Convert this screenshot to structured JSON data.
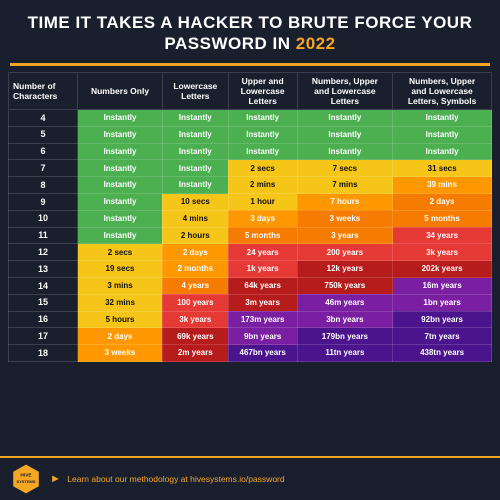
{
  "header": {
    "title": "TIME IT TAKES A HACKER TO BRUTE FORCE YOUR PASSWORD IN",
    "year": "2022"
  },
  "table": {
    "columns": [
      "Number of Characters",
      "Numbers Only",
      "Lowercase Letters",
      "Upper and Lowercase Letters",
      "Numbers, Upper and Lowercase Letters",
      "Numbers, Upper and Lowercase Letters, Symbols"
    ],
    "rows": [
      {
        "chars": "4",
        "num": "Instantly",
        "lower": "Instantly",
        "mixed": "Instantly",
        "num_mixed": "Instantly",
        "all": "Instantly",
        "colors": [
          "green",
          "green",
          "green",
          "green",
          "green"
        ]
      },
      {
        "chars": "5",
        "num": "Instantly",
        "lower": "Instantly",
        "mixed": "Instantly",
        "num_mixed": "Instantly",
        "all": "Instantly",
        "colors": [
          "green",
          "green",
          "green",
          "green",
          "green"
        ]
      },
      {
        "chars": "6",
        "num": "Instantly",
        "lower": "Instantly",
        "mixed": "Instantly",
        "num_mixed": "Instantly",
        "all": "Instantly",
        "colors": [
          "green",
          "green",
          "green",
          "green",
          "green"
        ]
      },
      {
        "chars": "7",
        "num": "Instantly",
        "lower": "Instantly",
        "mixed": "2 secs",
        "num_mixed": "7 secs",
        "all": "31 secs",
        "colors": [
          "green",
          "green",
          "yellow-cell",
          "yellow-cell",
          "yellow-cell"
        ]
      },
      {
        "chars": "8",
        "num": "Instantly",
        "lower": "Instantly",
        "mixed": "2 mins",
        "num_mixed": "7 mins",
        "all": "39 mins",
        "colors": [
          "green",
          "green",
          "yellow-cell",
          "yellow-cell",
          "orange-light"
        ]
      },
      {
        "chars": "9",
        "num": "Instantly",
        "lower": "10 secs",
        "mixed": "1 hour",
        "num_mixed": "7 hours",
        "all": "2 days",
        "colors": [
          "green",
          "yellow-cell",
          "yellow-cell",
          "orange-light",
          "orange"
        ]
      },
      {
        "chars": "10",
        "num": "Instantly",
        "lower": "4 mins",
        "mixed": "3 days",
        "num_mixed": "3 weeks",
        "all": "5 months",
        "colors": [
          "green",
          "yellow-cell",
          "orange-light",
          "orange",
          "orange"
        ]
      },
      {
        "chars": "11",
        "num": "Instantly",
        "lower": "2 hours",
        "mixed": "5 months",
        "num_mixed": "3 years",
        "all": "34 years",
        "colors": [
          "green",
          "yellow-cell",
          "orange",
          "orange",
          "red"
        ]
      },
      {
        "chars": "12",
        "num": "2 secs",
        "lower": "2 days",
        "mixed": "24 years",
        "num_mixed": "200 years",
        "all": "3k years",
        "colors": [
          "yellow-cell",
          "orange-light",
          "red",
          "red",
          "red"
        ]
      },
      {
        "chars": "13",
        "num": "19 secs",
        "lower": "2 months",
        "mixed": "1k years",
        "num_mixed": "12k years",
        "all": "202k years",
        "colors": [
          "yellow-cell",
          "orange-light",
          "red",
          "dark-red",
          "dark-red"
        ]
      },
      {
        "chars": "14",
        "num": "3 mins",
        "lower": "4 years",
        "mixed": "64k years",
        "num_mixed": "750k years",
        "all": "16m years",
        "colors": [
          "yellow-cell",
          "orange",
          "dark-red",
          "dark-red",
          "purple"
        ]
      },
      {
        "chars": "15",
        "num": "32 mins",
        "lower": "100 years",
        "mixed": "3m years",
        "num_mixed": "46m years",
        "all": "1bn years",
        "colors": [
          "yellow-cell",
          "red",
          "dark-red",
          "purple",
          "purple"
        ]
      },
      {
        "chars": "16",
        "num": "5 hours",
        "lower": "3k years",
        "mixed": "173m years",
        "num_mixed": "3bn years",
        "all": "92bn years",
        "colors": [
          "yellow-cell",
          "red",
          "purple",
          "purple",
          "dark-purple"
        ]
      },
      {
        "chars": "17",
        "num": "2 days",
        "lower": "69k years",
        "mixed": "9bn years",
        "num_mixed": "179bn years",
        "all": "7tn years",
        "colors": [
          "orange-light",
          "dark-red",
          "purple",
          "dark-purple",
          "dark-purple"
        ]
      },
      {
        "chars": "18",
        "num": "3 weeks",
        "lower": "2m years",
        "mixed": "467bn years",
        "num_mixed": "11tn years",
        "all": "438tn years",
        "colors": [
          "orange-light",
          "dark-red",
          "dark-purple",
          "dark-purple",
          "dark-purple"
        ]
      }
    ]
  },
  "footer": {
    "logo_text": "HIVE SYSTEMS",
    "cta": "Learn about our methodology at hivesystems.io/password"
  }
}
